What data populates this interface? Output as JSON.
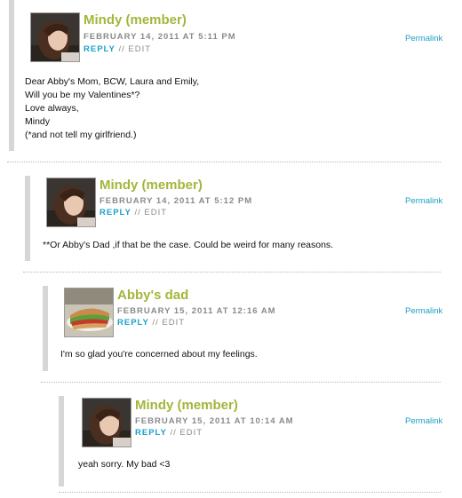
{
  "comments": [
    {
      "author": "Mindy (member)",
      "date": "FEBRUARY 14, 2011 AT 5:11 PM",
      "reply": "REPLY",
      "separator": "//",
      "edit": "EDIT",
      "permalink": "Permalink",
      "avatar_icon": "woman-portrait-avatar",
      "lines": [
        "Dear Abby's Mom, BCW, Laura and Emily,",
        "Will you be my Valentines*?",
        "Love always,",
        "Mindy",
        "(*and not tell my girlfriend.)"
      ]
    },
    {
      "author": "Mindy (member)",
      "date": "FEBRUARY 14, 2011 AT 5:12 PM",
      "reply": "REPLY",
      "separator": "//",
      "edit": "EDIT",
      "permalink": "Permalink",
      "avatar_icon": "woman-portrait-avatar",
      "lines": [
        "**Or Abby's Dad ,if that be the case. Could be weird for many reasons."
      ]
    },
    {
      "author": "Abby's dad",
      "date": "FEBRUARY 15, 2011 AT 12:16 AM",
      "reply": "REPLY",
      "separator": "//",
      "edit": "EDIT",
      "permalink": "Permalink",
      "avatar_icon": "sandwich-photo-avatar",
      "lines": [
        "I'm so glad you're concerned about my feelings."
      ]
    },
    {
      "author": "Mindy (member)",
      "date": "FEBRUARY 15, 2011 AT 10:14 AM",
      "reply": "REPLY",
      "separator": "//",
      "edit": "EDIT",
      "permalink": "Permalink",
      "avatar_icon": "woman-portrait-avatar",
      "lines": [
        "yeah sorry. My bad <3"
      ]
    }
  ]
}
